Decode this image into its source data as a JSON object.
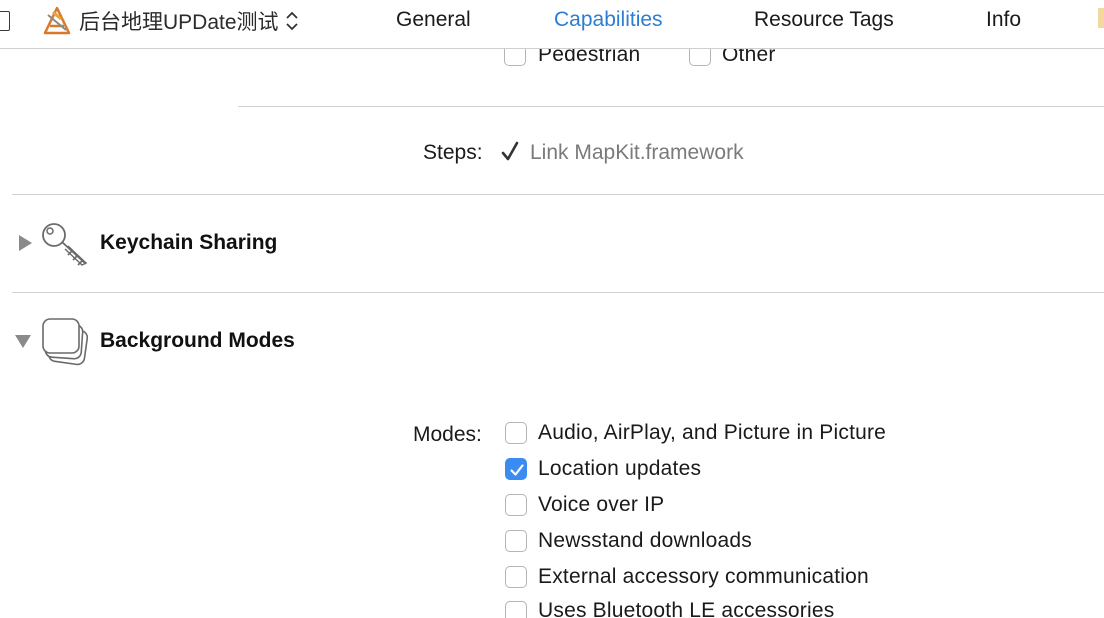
{
  "header": {
    "target_name": "后台地理UPDate测试",
    "tabs": [
      {
        "label": "General",
        "active": false
      },
      {
        "label": "Capabilities",
        "active": true
      },
      {
        "label": "Resource Tags",
        "active": false
      },
      {
        "label": "Info",
        "active": false
      }
    ],
    "accent_color": "#2d7dd2"
  },
  "maps": {
    "routing_options": [
      {
        "label": "Pedestrian",
        "checked": false
      },
      {
        "label": "Other",
        "checked": false
      }
    ],
    "steps_label": "Steps:",
    "steps": [
      {
        "text": "Link MapKit.framework",
        "done": true
      }
    ]
  },
  "sections": [
    {
      "title": "Keychain Sharing",
      "expanded": false,
      "icon": "keychain-icon"
    },
    {
      "title": "Background Modes",
      "expanded": true,
      "icon": "background-modes-icon"
    }
  ],
  "background_modes": {
    "modes_label": "Modes:",
    "options": [
      {
        "label": "Audio, AirPlay, and Picture in Picture",
        "checked": false
      },
      {
        "label": "Location updates",
        "checked": true
      },
      {
        "label": "Voice over IP",
        "checked": false
      },
      {
        "label": "Newsstand downloads",
        "checked": false
      },
      {
        "label": "External accessory communication",
        "checked": false
      },
      {
        "label": "Uses Bluetooth LE accessories",
        "checked": false
      }
    ],
    "checkbox_checked_color": "#3b8cf2"
  }
}
